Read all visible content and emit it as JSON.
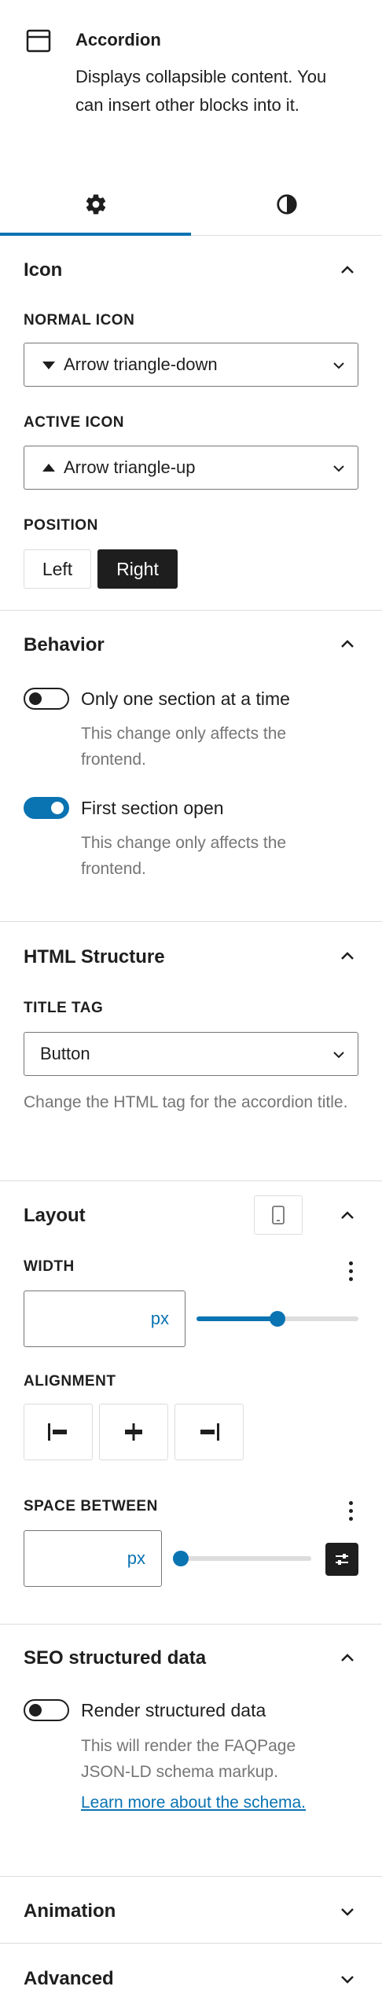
{
  "block": {
    "title": "Accordion",
    "description": "Displays collapsible content. You can insert other blocks into it.",
    "icon": "block-icon"
  },
  "tabs": [
    {
      "icon": "gear-icon",
      "active": true
    },
    {
      "icon": "contrast-icon",
      "active": false
    }
  ],
  "icon_panel": {
    "title": "Icon",
    "normal_label": "NORMAL ICON",
    "normal_value": "Arrow triangle-down",
    "active_label": "ACTIVE ICON",
    "active_value": "Arrow triangle-up",
    "position_label": "POSITION",
    "position_options": [
      "Left",
      "Right"
    ],
    "position_selected": "Right"
  },
  "behavior_panel": {
    "title": "Behavior",
    "toggle1_label": "Only one section at a time",
    "toggle1_help": "This change only affects the frontend.",
    "toggle1_on": false,
    "toggle2_label": "First section open",
    "toggle2_help": "This change only affects the frontend.",
    "toggle2_on": true
  },
  "html_panel": {
    "title": "HTML Structure",
    "tag_label": "TITLE TAG",
    "tag_value": "Button",
    "help": "Change the HTML tag for the accordion title."
  },
  "layout_panel": {
    "title": "Layout",
    "width_label": "WIDTH",
    "width_unit": "px",
    "width_slider": 0.5,
    "alignment_label": "ALIGNMENT",
    "alignment_options": [
      "align-left-icon",
      "align-center-icon",
      "align-right-icon"
    ],
    "space_label": "SPACE BETWEEN",
    "space_unit": "px",
    "space_slider": 0.0
  },
  "seo_panel": {
    "title": "SEO structured data",
    "toggle_label": "Render structured data",
    "toggle_on": false,
    "help": "This will render the FAQPage JSON-LD schema markup.",
    "link_text": "Learn more about the schema."
  },
  "collapsed_panels": {
    "animation": "Animation",
    "advanced": "Advanced"
  },
  "colors": {
    "accent": "#0a73b2",
    "text": "#1e1e1e",
    "muted": "#757575",
    "border": "#dddddd"
  }
}
